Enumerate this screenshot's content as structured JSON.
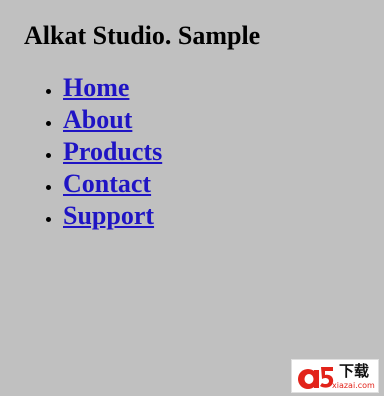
{
  "page": {
    "title": "Alkat Studio. Sample"
  },
  "nav": {
    "items": [
      {
        "label": "Home"
      },
      {
        "label": "About"
      },
      {
        "label": "Products"
      },
      {
        "label": "Contact"
      },
      {
        "label": "Support"
      }
    ]
  },
  "colors": {
    "background": "#c0c0c0",
    "link": "#1f14c4",
    "watermark_red": "#e2231a"
  },
  "watermark": {
    "chinese_text": "下载",
    "url_text": "xiazai.com"
  }
}
